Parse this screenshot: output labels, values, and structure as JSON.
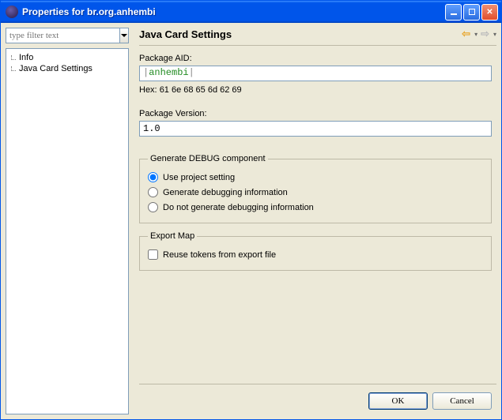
{
  "window": {
    "title": "Properties for br.org.anhembi"
  },
  "sidebar": {
    "filter_placeholder": "type filter text",
    "items": [
      {
        "label": "Info"
      },
      {
        "label": "Java Card Settings"
      }
    ]
  },
  "page": {
    "title": "Java Card Settings",
    "package_aid_label": "Package AID:",
    "package_aid_prefix": "|",
    "package_aid_value": "anhembi",
    "package_aid_suffix": "|",
    "hex_label": "Hex:",
    "hex_value": "61 6e 68 65 6d 62 69",
    "package_version_label": "Package Version:",
    "package_version_value": "1.0",
    "debug_group_title": "Generate DEBUG component",
    "debug_options": [
      {
        "label": "Use project setting",
        "selected": true
      },
      {
        "label": "Generate debugging information",
        "selected": false
      },
      {
        "label": "Do not generate debugging information",
        "selected": false
      }
    ],
    "export_group_title": "Export Map",
    "export_reuse_label": "Reuse tokens from export file",
    "export_reuse_checked": false
  },
  "buttons": {
    "ok": "OK",
    "cancel": "Cancel"
  }
}
